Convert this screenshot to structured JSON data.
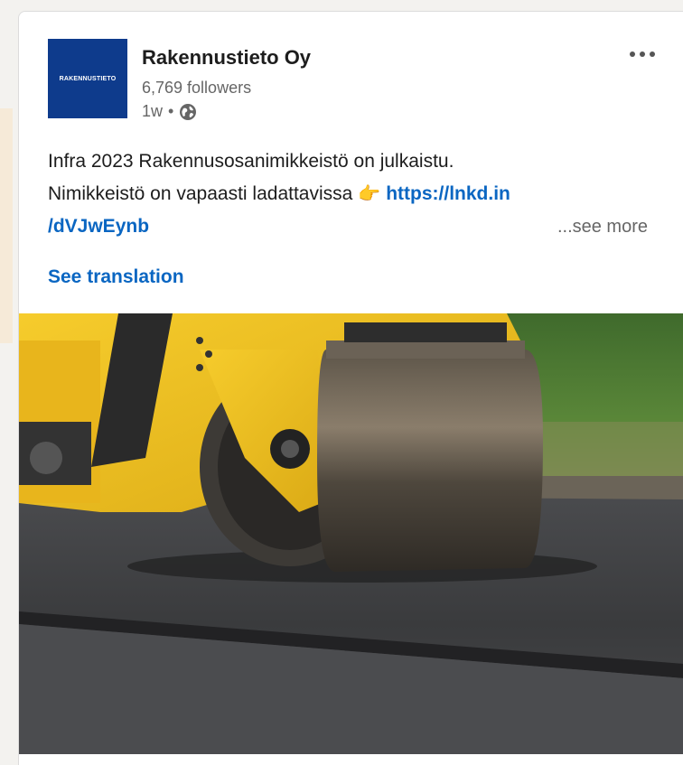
{
  "post": {
    "author": "Rakennustieto Oy",
    "logo_text": "RAKENNUSTIETO",
    "followers": "6,769 followers",
    "time": "1w",
    "separator": "•",
    "text_line1": "Infra 2023 Rakennusosanimikkeistö on julkaistu.",
    "text_line2": "Nimikkeistö on vapaasti ladattavissa",
    "emoji": "👉",
    "link_part1": "https://lnkd.in",
    "link_part2": "/dVJwEynb",
    "see_more": "...see more",
    "see_translation": "See translation"
  },
  "icons": {
    "globe": "globe-icon",
    "more": "more-options-icon",
    "pointing": "pointing-right-emoji"
  },
  "colors": {
    "link": "#0a66c2",
    "logo_bg": "#0e3b8c",
    "roller_yellow": "#f2c12a",
    "asphalt": "#3f3f41"
  }
}
